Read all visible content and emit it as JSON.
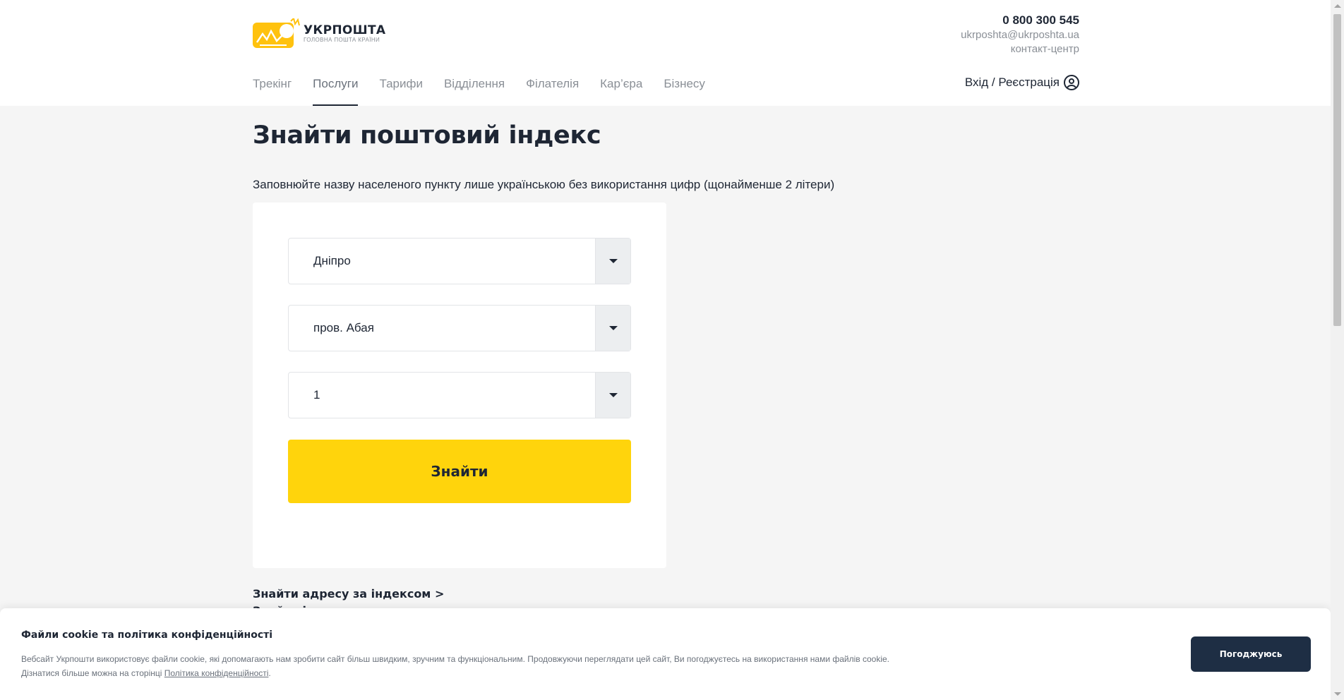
{
  "header": {
    "logo_title": "УКРПОШТА",
    "logo_subtitle": "ГОЛОВНА ПОШТА КРАЇНИ",
    "phone": "0 800 300 545",
    "email": "ukrposhta@ukrposhta.ua",
    "contact_center": "контакт-центр",
    "login_label": "Вхід / Реєстрація"
  },
  "nav": {
    "items": [
      {
        "label": "Трекінг"
      },
      {
        "label": "Послуги",
        "active": true
      },
      {
        "label": "Тарифи"
      },
      {
        "label": "Відділення"
      },
      {
        "label": "Філателія"
      },
      {
        "label": "Кар’єра"
      },
      {
        "label": "Бізнесу"
      }
    ]
  },
  "main": {
    "title": "Знайти поштовий індекс",
    "hint": "Заповнюйте назву населеного пункту лише українською без використання цифр (щонайменше 2 літери)",
    "fields": [
      {
        "value": "Дніпро"
      },
      {
        "value": "пров. Абая"
      },
      {
        "value": "1"
      }
    ],
    "find_button": "Знайти",
    "link_address": "Знайти адресу за індексом >",
    "link_second": "Знайти індекс..."
  },
  "cookie": {
    "title": "Файли cookie та політика конфіденційності",
    "text_line1": "Вебсайт Укрпошти використовує файли cookie, які допомагають нам зробити сайт більш швидким, зручним та функціональним. Продовжуючи переглядати цей сайт, Ви погоджуєтесь на використання нами файлів cookie.",
    "text_line2_prefix": "Дізнатися більше можна на сторінці ",
    "policy_link": "Політика конфіденційності",
    "text_line2_suffix": ".",
    "accept_button": "Погоджуюсь"
  },
  "colors": {
    "brand_yellow": "#ffd40c",
    "text_dark": "#1e2634",
    "text_muted": "#8a8f96",
    "button_dark": "#1e2e44",
    "page_bg": "#f5f5f5"
  }
}
